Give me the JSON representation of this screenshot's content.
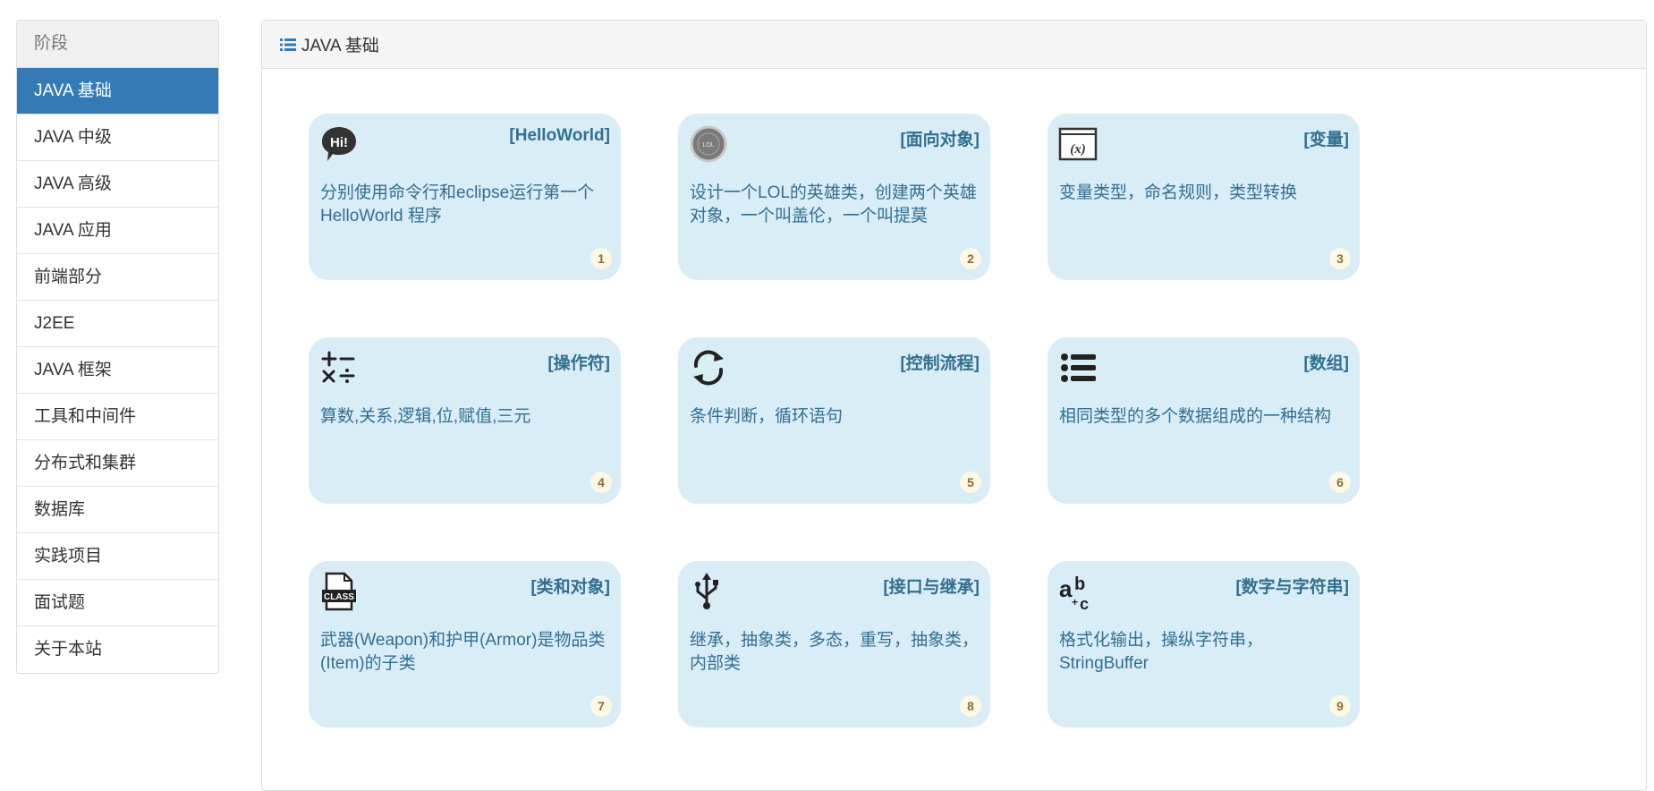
{
  "sidebar": {
    "header": "阶段",
    "items": [
      {
        "label": "JAVA 基础",
        "active": true
      },
      {
        "label": "JAVA 中级"
      },
      {
        "label": "JAVA 高级"
      },
      {
        "label": "JAVA 应用"
      },
      {
        "label": "前端部分"
      },
      {
        "label": "J2EE"
      },
      {
        "label": "JAVA 框架"
      },
      {
        "label": "工具和中间件"
      },
      {
        "label": "分布式和集群"
      },
      {
        "label": "数据库"
      },
      {
        "label": "实践项目"
      },
      {
        "label": "面试题"
      },
      {
        "label": "关于本站"
      }
    ]
  },
  "panel": {
    "title": "JAVA 基础",
    "title_icon": "list-icon"
  },
  "cards": [
    {
      "title": "[HelloWorld]",
      "desc": "分别使用命令行和eclipse运行第一个HelloWorld 程序",
      "num": "1",
      "icon": "hi-speech-icon"
    },
    {
      "title": "[面向对象]",
      "desc": "设计一个LOL的英雄类，创建两个英雄对象，一个叫盖伦，一个叫提莫",
      "num": "2",
      "icon": "lol-logo-icon"
    },
    {
      "title": "[变量]",
      "desc": "变量类型，命名规则，类型转换",
      "num": "3",
      "icon": "variable-icon"
    },
    {
      "title": "[操作符]",
      "desc": "算数,关系,逻辑,位,赋值,三元",
      "num": "4",
      "icon": "math-operators-icon"
    },
    {
      "title": "[控制流程]",
      "desc": "条件判断，循环语句",
      "num": "5",
      "icon": "loop-arrows-icon"
    },
    {
      "title": "[数组]",
      "desc": "相同类型的多个数据组成的一种结构",
      "num": "6",
      "icon": "list-bullets-icon"
    },
    {
      "title": "[类和对象]",
      "desc": "武器(Weapon)和护甲(Armor)是物品类(Item)的子类",
      "num": "7",
      "icon": "class-file-icon"
    },
    {
      "title": "[接口与继承]",
      "desc": "继承，抽象类，多态，重写，抽象类，内部类",
      "num": "8",
      "icon": "usb-icon"
    },
    {
      "title": "[数字与字符串]",
      "desc": "格式化输出，操纵字符串，StringBuffer",
      "num": "9",
      "icon": "abc-text-icon"
    }
  ],
  "colors": {
    "active": "#337ab7",
    "card_bg": "#d9edf7",
    "card_text": "#31708f",
    "badge_bg": "#fcf8e3",
    "badge_text": "#8a6d3b"
  }
}
